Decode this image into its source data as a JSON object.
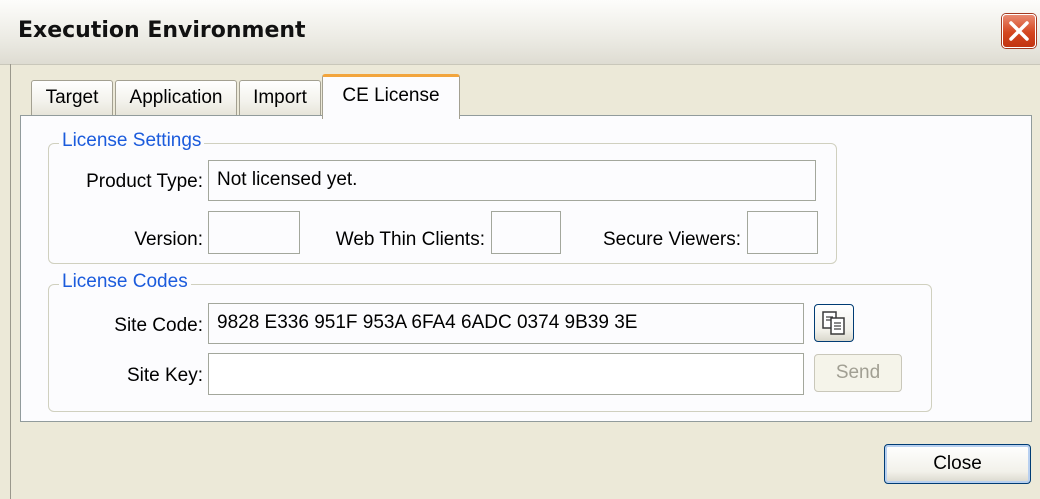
{
  "window": {
    "title": "Execution Environment"
  },
  "tabs": [
    {
      "label": "Target"
    },
    {
      "label": "Application"
    },
    {
      "label": "Import"
    },
    {
      "label": "CE License",
      "active": true
    }
  ],
  "license_settings": {
    "group_title": "License Settings",
    "product_type_label": "Product Type:",
    "product_type_value": "Not licensed yet.",
    "version_label": "Version:",
    "version_value": "",
    "web_thin_clients_label": "Web Thin Clients:",
    "web_thin_clients_value": "",
    "secure_viewers_label": "Secure Viewers:",
    "secure_viewers_value": ""
  },
  "license_codes": {
    "group_title": "License Codes",
    "site_code_label": "Site Code:",
    "site_code_value": "9828 E336 951F 953A 6FA4 6ADC 0374 9B39 3E",
    "site_key_label": "Site Key:",
    "site_key_value": "",
    "copy_icon": "copy-icon",
    "send_label": "Send"
  },
  "footer": {
    "close_label": "Close"
  },
  "colors": {
    "accent": "#1b5bdc",
    "tab_highlight": "#f2a53d",
    "close_red": "#d4461f"
  }
}
